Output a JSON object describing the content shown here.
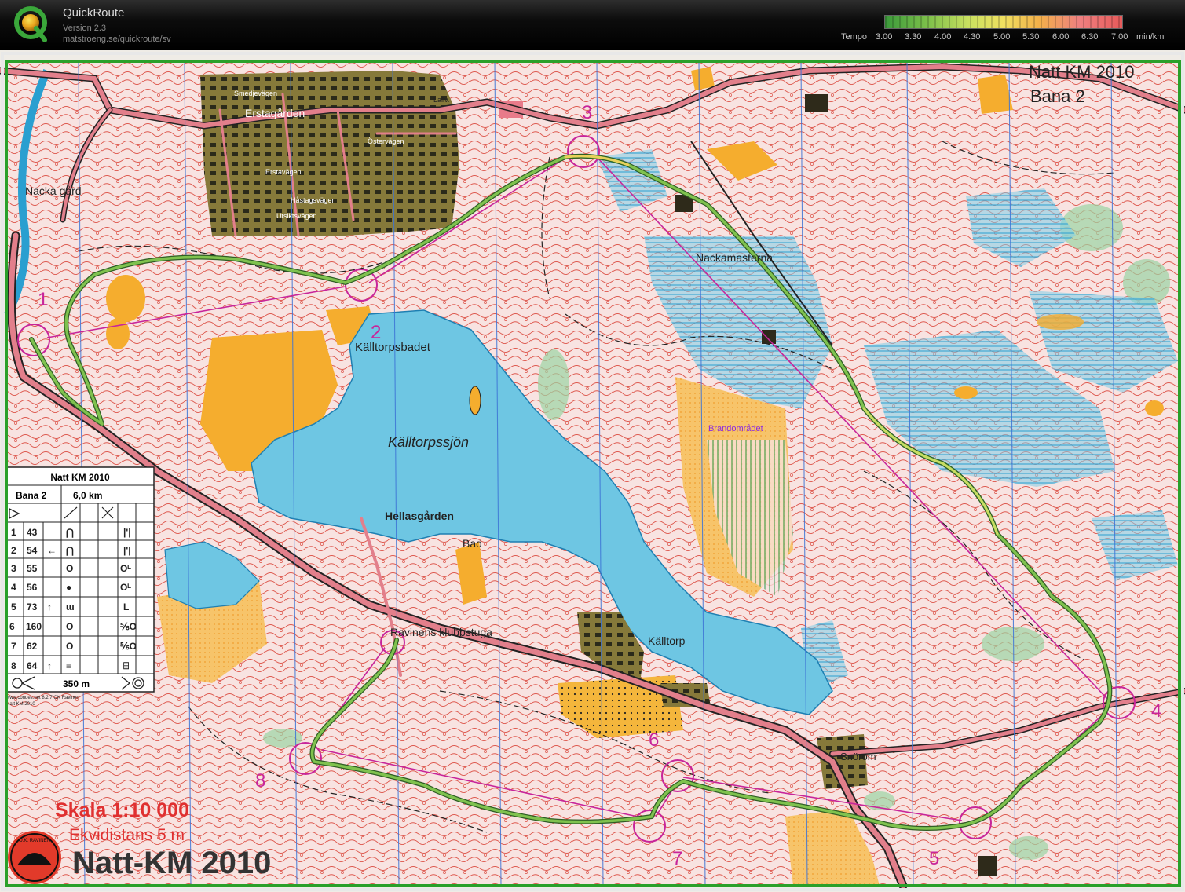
{
  "app": {
    "name": "QuickRoute",
    "version": "Version 2.3",
    "url": "matstroeng.se/quickroute/sv"
  },
  "tempo_scale": {
    "label": "Tempo",
    "ticks": [
      "3.00",
      "3.30",
      "4.00",
      "4.30",
      "5.00",
      "5.30",
      "6.00",
      "6.30",
      "7.00"
    ],
    "unit": "min/km"
  },
  "map": {
    "event_title": "Natt KM 2010",
    "course": "Bana 2",
    "place_names": {
      "erstagarden": "Erstagården",
      "nacka_gard": "Nacka gård",
      "smedjevagen": "Smedjevägen",
      "erstavagen": "Erstavägen",
      "ostervagen": "Östervägen",
      "hastagsvagen": "Håstagsvägen",
      "utsiktsvagen": "Utsiktsvägen",
      "lallv": "Lallv.",
      "kalltorpsbadet": "Källtorpsbadet",
      "kalltorpssjon": "Källtorpssjön",
      "hellasgarden": "Hellasgården",
      "bad": "Bad",
      "ravinens_klubbstuga": "Ravinens klubbstuga",
      "kalltorp": "Källtorp",
      "nackamasterna": "Nackamasterna",
      "brandomradet": "Brandområdet",
      "snorom": "Snörom"
    },
    "control_numbers": [
      "1",
      "2",
      "3",
      "4",
      "5",
      "6",
      "7",
      "8"
    ],
    "scale_text": "Skala 1:10 000",
    "contour_text": "Ekvidistans 5 m",
    "footer_title": "Natt-KM 2010",
    "club_logo_text": "O.K. RAVINEN",
    "credit_lines": [
      "www.condes.net 8.2.7 OK Ravinen",
      "Natt KM 2010"
    ]
  },
  "control_descriptions": {
    "title": "Natt KM 2010",
    "course": "Bana 2",
    "length": "6,0 km",
    "rows": [
      {
        "num": "1",
        "code": "43",
        "arrow": "",
        "feature": "⋂",
        "detail": "|'|"
      },
      {
        "num": "2",
        "code": "54",
        "arrow": "←",
        "feature": "⋂",
        "detail": "|'|"
      },
      {
        "num": "3",
        "code": "55",
        "arrow": "",
        "feature": "O",
        "detail": "Oᴸ"
      },
      {
        "num": "4",
        "code": "56",
        "arrow": "",
        "feature": "●",
        "detail": "Oᴸ"
      },
      {
        "num": "5",
        "code": "73",
        "arrow": "↑",
        "feature": "ɯ",
        "detail": "L"
      },
      {
        "num": "6",
        "code": "160",
        "arrow": "",
        "feature": "O",
        "detail": "⅚O"
      },
      {
        "num": "7",
        "code": "62",
        "arrow": "",
        "feature": "O",
        "detail": "⅚O"
      },
      {
        "num": "8",
        "code": "64",
        "arrow": "↑",
        "feature": "≡",
        "detail": "⌸"
      }
    ],
    "finish_distance": "350 m"
  },
  "colors": {
    "control_magenta": "#c8259a",
    "route_green": "#4a8f3a",
    "water": "#6ec6e3",
    "open_yellow": "#f6b13a",
    "urban_olive": "#7a6f2a",
    "contour": "#d9463b",
    "road": "#e27f8b",
    "map_base": "#f7e5e4"
  }
}
